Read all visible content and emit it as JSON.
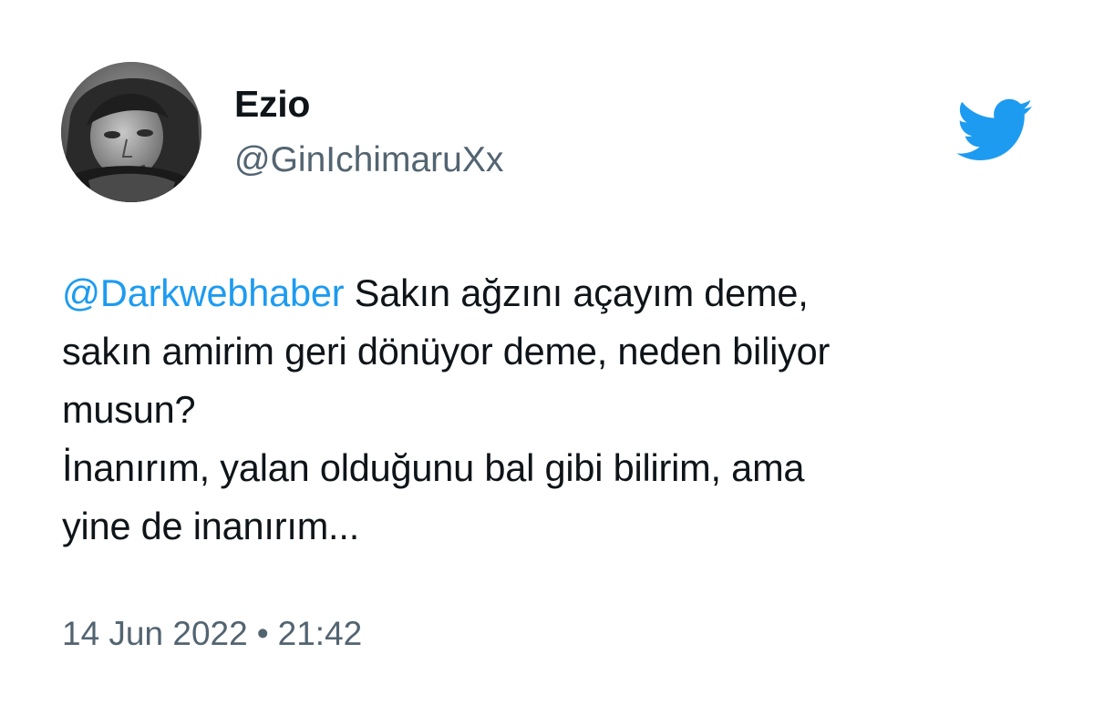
{
  "tweet": {
    "author": {
      "display_name": "Ezio",
      "handle": "@GinIchimaruXx",
      "avatar_icon": "profile-photo"
    },
    "brand_icon": "twitter-bird-icon",
    "text": {
      "mention": "@Darkwebhaber",
      "line1_rest": " Sakın ağzını açayım deme,",
      "line2": "sakın amirim geri dönüyor deme, neden biliyor",
      "line3": "musun?",
      "line4": "İnanırım, yalan olduğunu bal gibi bilirim, ama",
      "line5": "yine de inanırım..."
    },
    "date": "14 Jun 2022",
    "separator": "•",
    "time": "21:42"
  },
  "colors": {
    "accent": "#1d9bf0",
    "text_primary": "#0f1419",
    "text_secondary": "#536471",
    "background": "#ffffff"
  }
}
